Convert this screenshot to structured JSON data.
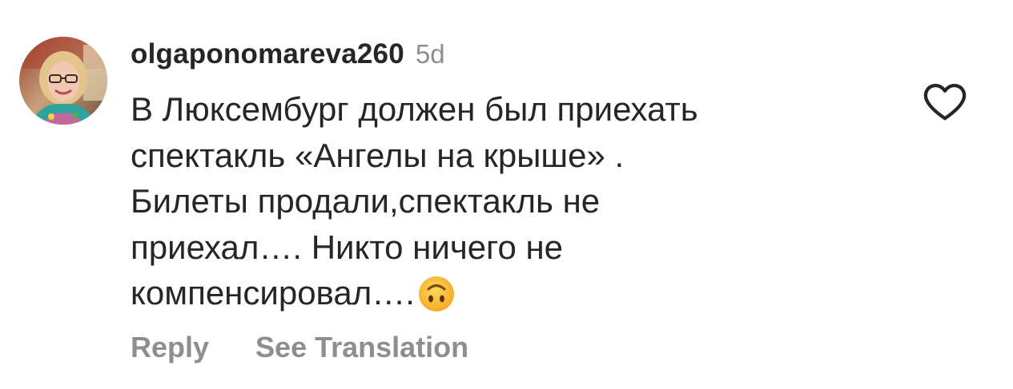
{
  "comment": {
    "username": "olgaponomareva260",
    "time": "5d",
    "text_lines": [
      "В Люксембург должен был приехать",
      "спектакль «Ангелы на крыше» .",
      "Билеты продали,спектакль не",
      "приехал…. Никто ничего не",
      "компенсировал…."
    ],
    "emoji": "upside-down-face-emoji",
    "like_icon": "heart-outline-icon"
  },
  "actions": {
    "reply": "Reply",
    "see_translation": "See Translation"
  },
  "colors": {
    "text": "#262626",
    "secondary": "#8e8e8e",
    "background": "#ffffff",
    "emoji_yellow": "#fbbf33"
  }
}
